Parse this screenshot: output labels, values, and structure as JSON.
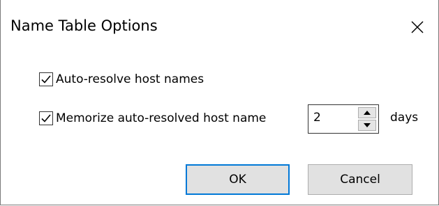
{
  "dialog": {
    "title": "Name Table Options",
    "close_icon": "close-icon"
  },
  "options": {
    "auto_resolve": {
      "label": "Auto-resolve host names",
      "checked": true
    },
    "memorize": {
      "label": "Memorize auto-resolved host name",
      "checked": true
    }
  },
  "duration": {
    "value": "2",
    "unit": "days"
  },
  "buttons": {
    "ok": "OK",
    "cancel": "Cancel"
  },
  "colors": {
    "default_button_border": "#0078d7",
    "button_face": "#e1e1e1"
  }
}
